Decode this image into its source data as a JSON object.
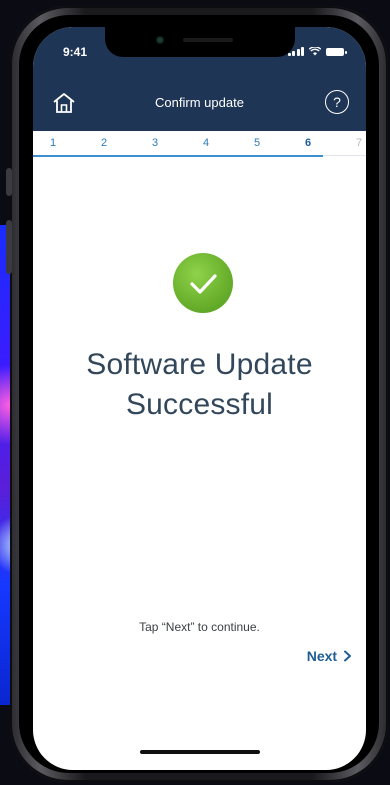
{
  "status_bar": {
    "time": "9:41"
  },
  "header": {
    "title": "Confirm update",
    "help_label": "?"
  },
  "steps": [
    {
      "label": "1",
      "state": "done"
    },
    {
      "label": "2",
      "state": "done"
    },
    {
      "label": "3",
      "state": "done"
    },
    {
      "label": "4",
      "state": "done"
    },
    {
      "label": "5",
      "state": "done"
    },
    {
      "label": "6",
      "state": "current"
    },
    {
      "label": "7",
      "state": "future"
    }
  ],
  "main": {
    "headline_line1": "Software Update",
    "headline_line2": "Successful",
    "hint": "Tap “Next” to continue.",
    "next_label": "Next"
  },
  "icons": {
    "home": "home-icon",
    "help": "help-icon",
    "success": "checkmark-icon",
    "next": "chevron-right-icon"
  },
  "colors": {
    "header_bg": "#1f3556",
    "accent": "#1f5e95",
    "success": "#6cb22e",
    "text": "#33475b"
  }
}
